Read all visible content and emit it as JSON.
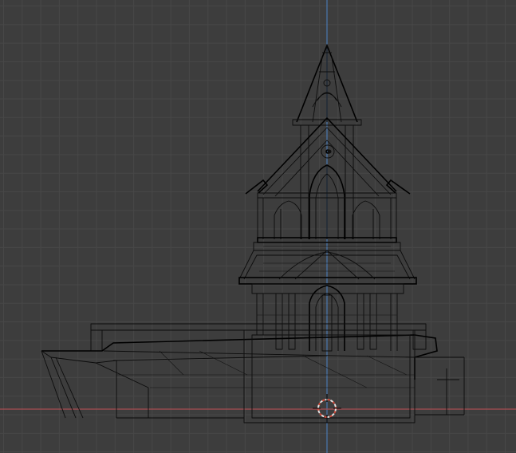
{
  "viewport": {
    "background_color": "#3d3d3d",
    "grid_color": "#474747",
    "wire_color": "#0c0c0c",
    "x_axis_color": "#a84e52",
    "y_axis_color": "#4a78b0",
    "cursor_colors": [
      "#e6e6e6",
      "#d04a3a"
    ]
  },
  "icons": {
    "cursor": "3d-cursor-icon",
    "origin": "object-origin-icon"
  }
}
